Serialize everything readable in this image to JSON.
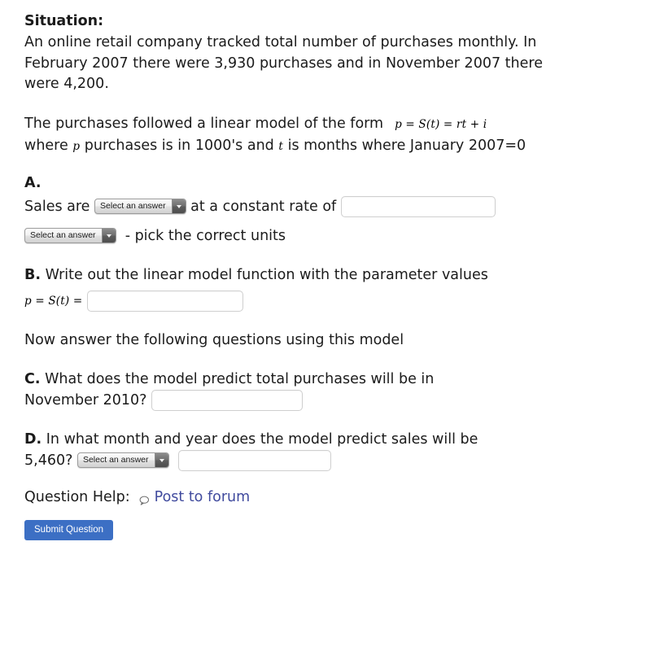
{
  "situation": {
    "heading": "Situation:",
    "body": "An online retail company tracked total number of purchases monthly. In February 2007 there were 3,930 purchases and in November 2007 there were 4,200.",
    "model_intro": "The purchases followed a linear model of the form",
    "model_formula": "p = S(t) = rt + i",
    "model_where_1": "where",
    "model_var_p": "p",
    "model_where_2": "purchases is in 1000's and",
    "model_var_t": "t",
    "model_where_3": "is months where January 2007=0"
  },
  "part_a": {
    "letter": "A.",
    "lead_text": "Sales are",
    "mid_text": "at a constant rate of",
    "trend_select": {
      "value": "Select an answer",
      "arrow": "chevron-down-icon"
    },
    "rate_input": {
      "value": "",
      "placeholder": ""
    },
    "units_select": {
      "value": "Select an answer",
      "arrow": "chevron-down-icon"
    },
    "units_hint": "- pick the correct units"
  },
  "part_b": {
    "letter": "B.",
    "prompt": "Write out the linear model function with the parameter values",
    "formula_prefix": "p = S(t) =",
    "model_input": {
      "value": "",
      "placeholder": ""
    }
  },
  "transition": "Now answer the following questions using this model",
  "part_c": {
    "letter": "C.",
    "prompt_line1": "What does the model predict total purchases will be in",
    "prompt_line2": "November 2010?",
    "answer_input": {
      "value": "",
      "placeholder": ""
    }
  },
  "part_d": {
    "letter": "D.",
    "prompt_line1": "In what month and year does the model predict sales will be",
    "prompt_line2": "5,460?",
    "month_select": {
      "value": "Select an answer",
      "arrow": "chevron-down-icon"
    },
    "year_input": {
      "value": "",
      "placeholder": ""
    }
  },
  "footer": {
    "help_label": "Question Help:",
    "forum_link": "Post to forum",
    "forum_icon": "speech-bubble-icon",
    "submit_label": "Submit Question"
  },
  "colors": {
    "link": "#414b9e",
    "submit_button": "#3c6fc4",
    "text": "#1b1b1b",
    "input_border": "#cfcfcf",
    "select_border": "#9a9a9a"
  }
}
